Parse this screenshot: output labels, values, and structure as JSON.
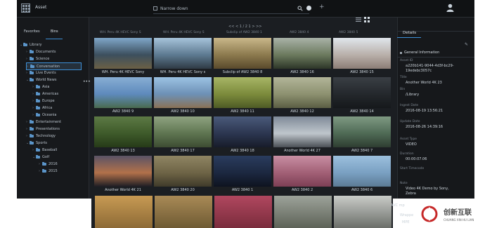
{
  "app": {
    "title": "Asset"
  },
  "header": {
    "search_placeholder": "Narrow down",
    "add": "+"
  },
  "left_panel": {
    "tabs": [
      {
        "label": "Favorites"
      },
      {
        "label": "Bins"
      }
    ],
    "tree": [
      {
        "label": "Library",
        "depth": 0,
        "expanded": true
      },
      {
        "label": "Documents",
        "depth": 1
      },
      {
        "label": "Science",
        "depth": 1
      },
      {
        "label": "Conversation",
        "depth": 1,
        "selected": true
      },
      {
        "label": "Live Events",
        "depth": 1
      },
      {
        "label": "World News",
        "depth": 1,
        "expanded": true
      },
      {
        "label": "Asia",
        "depth": 2
      },
      {
        "label": "Americas",
        "depth": 2
      },
      {
        "label": "Europe",
        "depth": 2
      },
      {
        "label": "Africa",
        "depth": 2
      },
      {
        "label": "Oceania",
        "depth": 2
      },
      {
        "label": "Entertainment",
        "depth": 1
      },
      {
        "label": "Presentations",
        "depth": 1
      },
      {
        "label": "Technology",
        "depth": 1
      },
      {
        "label": "Sports",
        "depth": 1,
        "expanded": true
      },
      {
        "label": "Baseball",
        "depth": 2
      },
      {
        "label": "Golf",
        "depth": 2,
        "expanded": true
      },
      {
        "label": "2016",
        "depth": 3
      },
      {
        "label": "2015",
        "depth": 3
      }
    ],
    "more": "•••"
  },
  "toolbar": {
    "pager": "<< < 1 / 2 1 > >>"
  },
  "grid": {
    "header_labels": [
      "WH. Peru 4K HEVC Sony S",
      "WH. Peru 4K HEVC Sony S",
      "Subclip of AW2 3840 1",
      "AW2 3840 4",
      "AW2 3840 5"
    ],
    "items": [
      {
        "caption": "WH. Peru 4K HEVC Sony",
        "colors": [
          "#7fa7c9",
          "#3c4f5e",
          "#6b6045"
        ]
      },
      {
        "caption": "WH. Peru 4K HEVC Sony s",
        "colors": [
          "#a7c3da",
          "#5d7a91",
          "#2f3a44"
        ]
      },
      {
        "caption": "Subclip of AW2 3840 8",
        "colors": [
          "#c9b78a",
          "#8c7a4e",
          "#5a4a2c"
        ]
      },
      {
        "caption": "AW2 3840 16",
        "colors": [
          "#a9b2a8",
          "#6c7a5e",
          "#2d3628"
        ]
      },
      {
        "caption": "AW2 3840 15",
        "colors": [
          "#e0e6ec",
          "#b9b0aa",
          "#8c7d76"
        ]
      },
      {
        "caption": "AW2 3840 9",
        "colors": [
          "#88aed4",
          "#5e8abc",
          "#4a6b4f"
        ]
      },
      {
        "caption": "AW2 3840 10",
        "colors": [
          "#9cc2e3",
          "#6d91b6",
          "#8a7256"
        ]
      },
      {
        "caption": "AW2 3840 11",
        "colors": [
          "#a7b566",
          "#7c8b3c",
          "#4e5b25"
        ]
      },
      {
        "caption": "AW2 3840 12",
        "colors": [
          "#b2b599",
          "#8d9170",
          "#5b5e44"
        ]
      },
      {
        "caption": "AW2 3840 14",
        "colors": [
          "#3a3f45",
          "#24282c",
          "#15181b"
        ]
      },
      {
        "caption": "AW2 3840 13",
        "colors": [
          "#5d7a45",
          "#3e5a2a",
          "#263a18"
        ]
      },
      {
        "caption": "AW2 3840 17",
        "colors": [
          "#8fa381",
          "#5e7551",
          "#3d4c32"
        ]
      },
      {
        "caption": "AW2 3840 18",
        "colors": [
          "#4a5a7a",
          "#2c3650",
          "#171c2a"
        ]
      },
      {
        "caption": "Another World 4K 27",
        "colors": [
          "#7f8a98",
          "#bfc6cc",
          "#4a4f55"
        ]
      },
      {
        "caption": "AW2 3840 7",
        "colors": [
          "#7f9a83",
          "#4f6a55",
          "#2e3d31"
        ]
      },
      {
        "caption": "Another World 4K 21",
        "colors": [
          "#5a5366",
          "#b2714a",
          "#1e1e24"
        ]
      },
      {
        "caption": "AW2 3840 20",
        "colors": [
          "#8f8563",
          "#6e6446",
          "#3f3a2a"
        ]
      },
      {
        "caption": "AW2 3840 1",
        "colors": [
          "#2a3c5e",
          "#1c2840",
          "#0e1320"
        ]
      },
      {
        "caption": "AW2 3840 2",
        "colors": [
          "#c88fa3",
          "#a26076",
          "#7d3f55"
        ]
      },
      {
        "caption": "AW2 3840 6",
        "colors": [
          "#9cc0de",
          "#7aa0c2",
          "#5c7b95"
        ]
      }
    ]
  },
  "bottom_strip": [
    {
      "colors": [
        "#c79a53",
        "#8d6a36"
      ]
    },
    {
      "colors": [
        "#a98a56",
        "#6e5a33"
      ]
    },
    {
      "colors": [
        "#b0475f",
        "#7a2c3c"
      ]
    },
    {
      "colors": [
        "#9da39a",
        "#5d6257"
      ]
    },
    {
      "colors": [
        "#c9ccc8",
        "#6b6e69"
      ]
    }
  ],
  "details": {
    "tab": "Details",
    "section": "General Information",
    "fields": [
      {
        "label": "Asset ID",
        "value": "a220b141-9044-4d3f-bc29-19edebc3057c"
      },
      {
        "label": "Title",
        "value": "Another World 4K 23"
      },
      {
        "label": "Bin",
        "value": "/Library"
      },
      {
        "label": "Ingest Date",
        "value": "2016-08-19 13:56:21"
      },
      {
        "label": "Update Date",
        "value": "2016-08-26 14:39:16"
      },
      {
        "label": "Asset Type",
        "value": "VIDEO"
      },
      {
        "label": "Duration",
        "value": "00:00:07.06"
      },
      {
        "label": "Start Timecode",
        "value": ""
      },
      {
        "label": "Note",
        "value": "Video 4K Demo by Sony, Zebra"
      }
    ],
    "avc": "AVC mp",
    "wrap": "Wrappe",
    "mpe": "MPE"
  },
  "watermark": {
    "text": "创新互联",
    "sub": "CHUANG XIN HU LIAN"
  }
}
